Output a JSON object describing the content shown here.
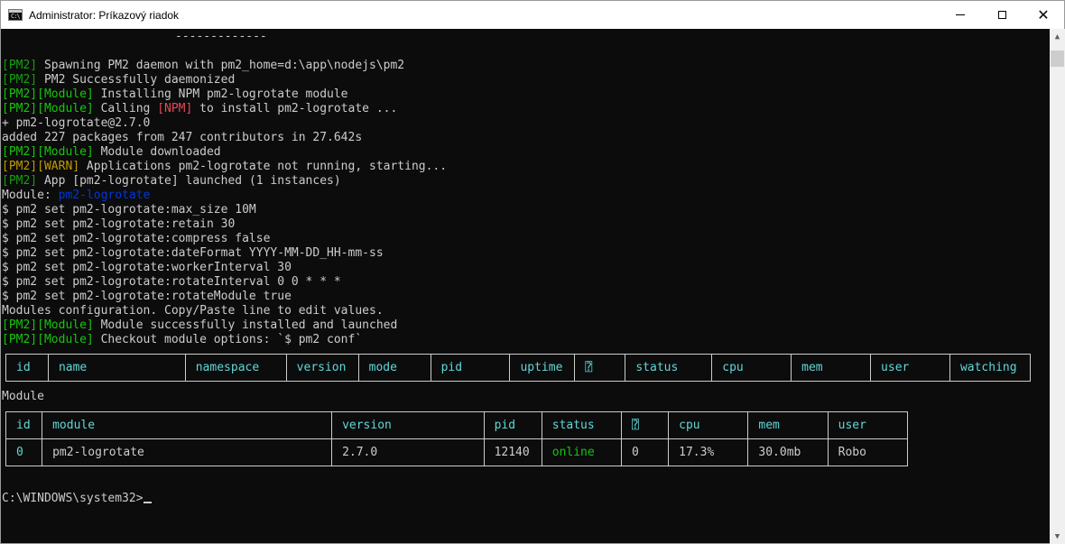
{
  "window": {
    "title": "Administrator: Príkazový riadok",
    "icon": "cmd-icon",
    "icon_glyph": "C:\\",
    "minimize_glyph": "—",
    "maximize_glyph": "☐",
    "close_glyph": "✕"
  },
  "console": {
    "separator": "-------------",
    "lines": [
      {
        "tag": "[PM2]",
        "text": " Spawning PM2 daemon with pm2_home=d:\\app\\nodejs\\pm2"
      },
      {
        "tag": "[PM2]",
        "text": " PM2 Successfully daemonized"
      },
      {
        "tag": "[PM2][Module]",
        "text": " Installing NPM pm2-logrotate module"
      },
      {
        "tag": "[PM2][Module]",
        "text": " Calling ",
        "npm_tag": "[NPM]",
        "text2": " to install pm2-logrotate ..."
      },
      {
        "text": "+ pm2-logrotate@2.7.0"
      },
      {
        "text": "added 227 packages from 247 contributors in 27.642s"
      },
      {
        "tag": "[PM2][Module]",
        "text": " Module downloaded"
      },
      {
        "tag": "[PM2][WARN]",
        "text": " Applications pm2-logrotate not running, starting..."
      },
      {
        "tag": "[PM2]",
        "text": " App [pm2-logrotate] launched (1 instances)"
      },
      {
        "text": "Module: ",
        "module_name": "pm2-logrotate"
      },
      {
        "text": "$ pm2 set pm2-logrotate:max_size 10M"
      },
      {
        "text": "$ pm2 set pm2-logrotate:retain 30"
      },
      {
        "text": "$ pm2 set pm2-logrotate:compress false"
      },
      {
        "text": "$ pm2 set pm2-logrotate:dateFormat YYYY-MM-DD_HH-mm-ss"
      },
      {
        "text": "$ pm2 set pm2-logrotate:workerInterval 30"
      },
      {
        "text": "$ pm2 set pm2-logrotate:rotateInterval 0 0 * * *"
      },
      {
        "text": "$ pm2 set pm2-logrotate:rotateModule true"
      },
      {
        "text": "Modules configuration. Copy/Paste line to edit values."
      },
      {
        "tag": "[PM2][Module]",
        "text": " Module successfully installed and launched"
      },
      {
        "tag": "[PM2][Module]",
        "text": " Checkout module options: `$ pm2 conf`"
      }
    ],
    "process_table": {
      "headers": [
        "id",
        "name",
        "namespace",
        "version",
        "mode",
        "pid",
        "uptime",
        "⍰",
        "status",
        "cpu",
        "mem",
        "user",
        "watching"
      ]
    },
    "module_label": "Module",
    "module_table": {
      "headers": [
        "id",
        "module",
        "version",
        "pid",
        "status",
        "⍰",
        "cpu",
        "mem",
        "user"
      ],
      "rows": [
        [
          "0",
          "pm2-logrotate",
          "2.7.0",
          "12140",
          "online",
          "0",
          "17.3%",
          "30.0mb",
          "Robo"
        ]
      ]
    },
    "prompt": "C:\\WINDOWS\\system32>"
  },
  "scrollbar": {
    "up_glyph": "▲",
    "down_glyph": "▼"
  },
  "colors": {
    "background": "#0c0c0c",
    "text": "#cccccc",
    "pm2_tag": "#13a10e",
    "module_tag": "#16c60c",
    "npm_tag": "#e74856",
    "warn_tag": "#c19c00",
    "module_name": "#0037da",
    "table_header": "#61d6d6",
    "status_online": "#16c60c"
  }
}
